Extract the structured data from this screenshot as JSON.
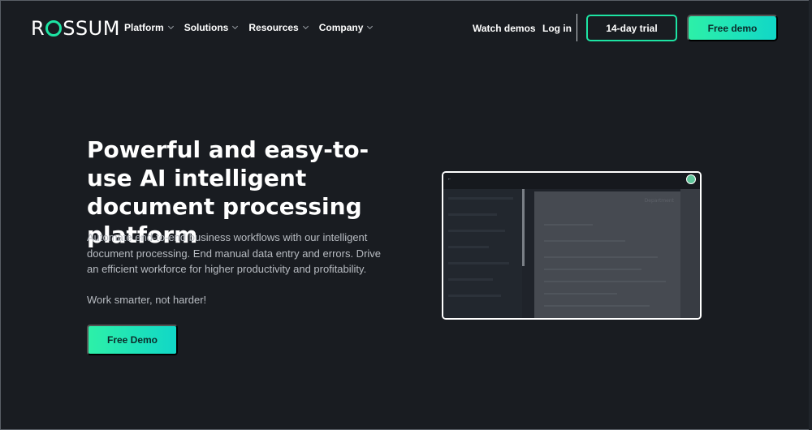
{
  "brand": {
    "name": "ROSSUM",
    "accent": "#1de4a3"
  },
  "nav": {
    "menu": [
      {
        "label": "Platform"
      },
      {
        "label": "Solutions"
      },
      {
        "label": "Resources"
      },
      {
        "label": "Company"
      }
    ],
    "watch_demos": "Watch demos",
    "login": "Log in",
    "trial_button": "14-day trial",
    "demo_button": "Free demo"
  },
  "hero": {
    "title": "Powerful and easy-to-use AI intelligent document processing platform",
    "subtitle": "Automate end-to-end business workflows with our intelligent document processing. End manual data entry and errors. Drive an efficient workforce for higher productivity and profitability.",
    "tagline": "Work smarter, not harder!",
    "cta": "Free Demo"
  },
  "preview": {
    "icon": "app-screenshot",
    "doc_title": "Department"
  }
}
